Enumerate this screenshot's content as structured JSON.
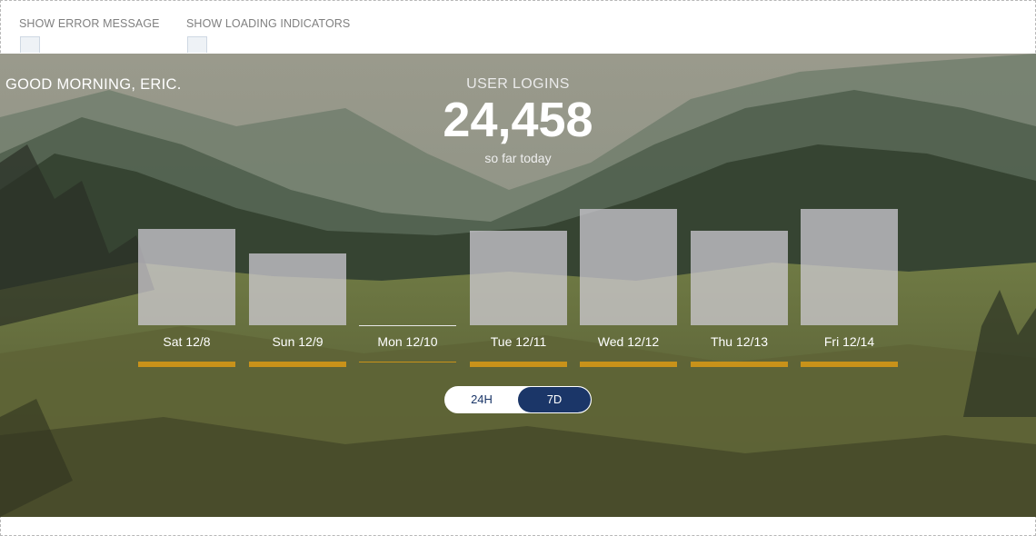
{
  "controls": {
    "show_error_label": "SHOW ERROR MESSAGE",
    "show_loading_label": "SHOW LOADING INDICATORS"
  },
  "greeting": "GOOD MORNING, ERIC.",
  "metric": {
    "label": "USER LOGINS",
    "value": "24,458",
    "sub": "so far today"
  },
  "chart_data": {
    "type": "bar",
    "categories": [
      "Sat 12/8",
      "Sun 12/9",
      "Mon 12/10",
      "Tue 12/11",
      "Wed 12/12",
      "Thu 12/13",
      "Fri 12/14"
    ],
    "values": [
      0.83,
      0.62,
      0.0,
      0.81,
      1.0,
      0.81,
      1.0
    ],
    "highlighted_category": "Mon 12/10",
    "accent_color": "#c8921a"
  },
  "range_toggle": {
    "options": [
      "24H",
      "7D"
    ],
    "selected": "7D"
  },
  "colors": {
    "accent": "#c8921a",
    "toggle_active": "#1b3668"
  }
}
